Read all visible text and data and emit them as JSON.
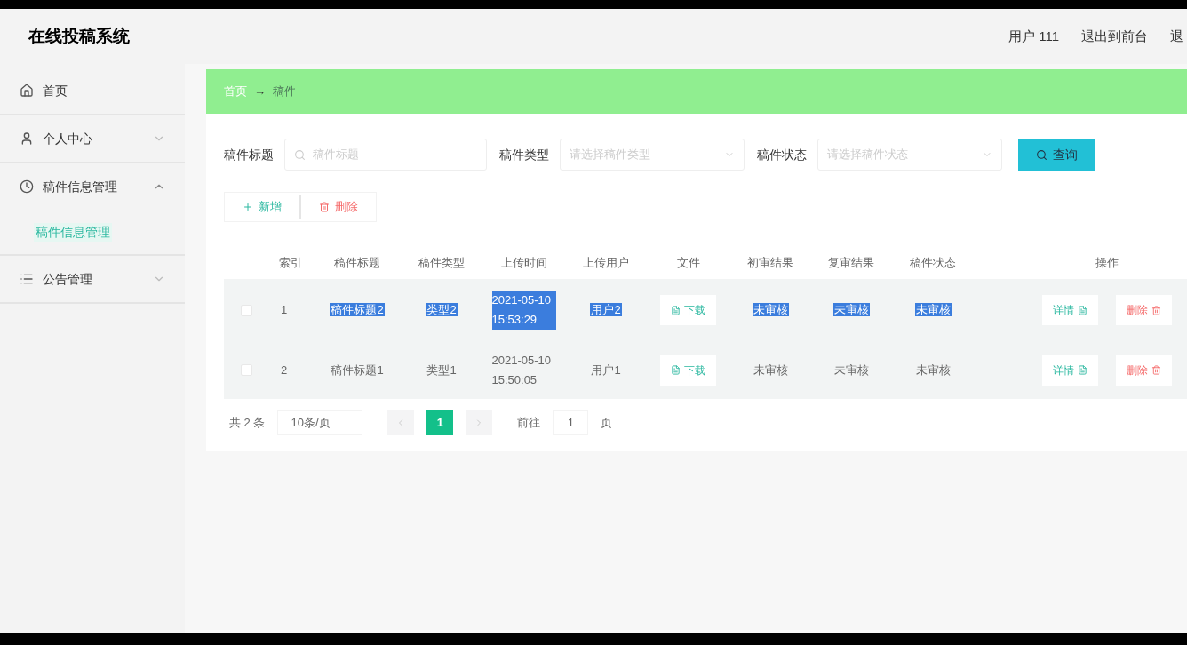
{
  "header": {
    "title": "在线投稿系统",
    "links": [
      "用户 111",
      "退出到前台",
      "退"
    ]
  },
  "sidebar": {
    "items": [
      {
        "label": "首页"
      },
      {
        "label": "个人中心",
        "expanded": false
      },
      {
        "label": "稿件信息管理",
        "expanded": true,
        "children": [
          {
            "label": "稿件信息管理",
            "selected": true
          }
        ]
      },
      {
        "label": "公告管理",
        "expanded": false
      }
    ]
  },
  "breadcrumb": [
    "首页",
    "稿件"
  ],
  "breadcrumb_separator": "→",
  "filters": [
    {
      "kind": "input",
      "label": "稿件标题",
      "placeholder": "稿件标题"
    },
    {
      "kind": "select",
      "label": "稿件类型",
      "placeholder": "请选择稿件类型"
    },
    {
      "kind": "select",
      "label": "稿件状态",
      "placeholder": "请选择稿件状态"
    }
  ],
  "search_button": "查询",
  "actions": [
    {
      "kind": "add",
      "label": "新增"
    },
    {
      "kind": "delete",
      "label": "删除"
    }
  ],
  "table": {
    "columns": [
      "索引",
      "稿件标题",
      "稿件类型",
      "上传时间",
      "上传用户",
      "文件",
      "初审结果",
      "复审结果",
      "稿件状态",
      "",
      "操作"
    ],
    "rows": [
      {
        "checked": false,
        "text_selected": true,
        "index": "1",
        "title": "稿件标题2",
        "type": "类型2",
        "time": "2021-05-10 15:53:29",
        "user": "用户2",
        "file": "下载",
        "first": "未审核",
        "second": "未审核",
        "status": "未审核",
        "detail": "详情",
        "delete": "删除"
      },
      {
        "checked": false,
        "text_selected": false,
        "index": "2",
        "title": "稿件标题1",
        "type": "类型1",
        "time": "2021-05-10 15:50:05",
        "user": "用户1",
        "file": "下载",
        "first": "未审核",
        "second": "未审核",
        "status": "未审核",
        "detail": "详情",
        "delete": "删除"
      }
    ]
  },
  "pagination": {
    "total": "共 2 条",
    "page_size": "10条/页",
    "pages": [
      {
        "label": "1",
        "selected": true
      }
    ],
    "goto_label": "前往",
    "goto_value": "1",
    "goto_suffix": "页"
  }
}
